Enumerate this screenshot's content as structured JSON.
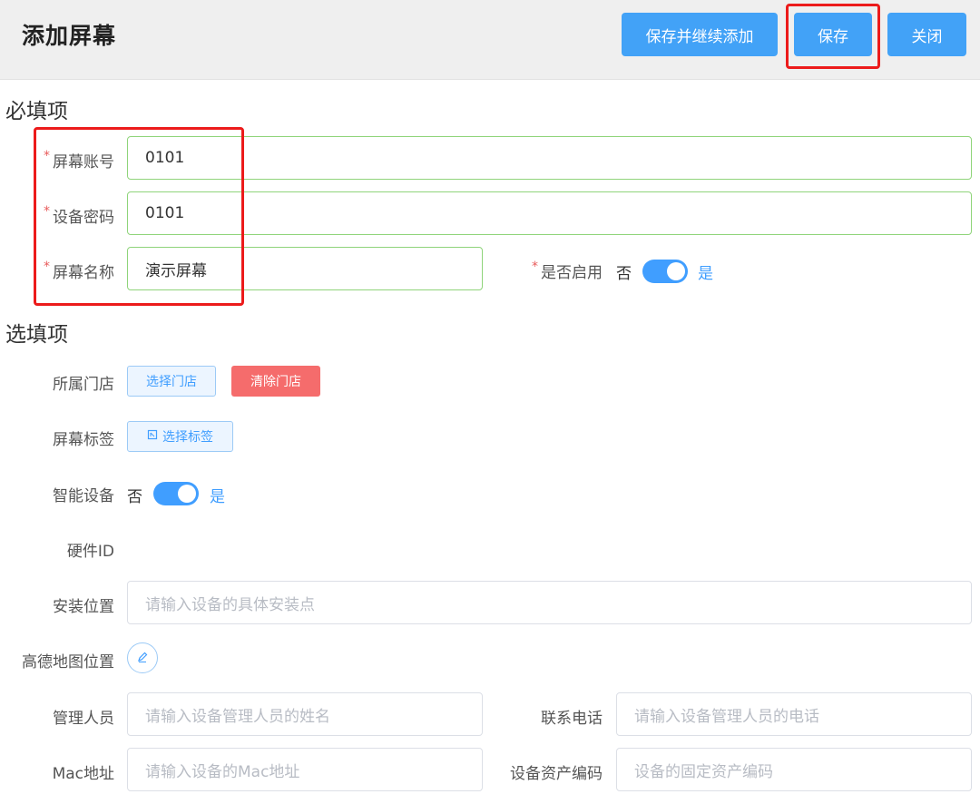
{
  "header": {
    "title": "添加屏幕",
    "save_continue_label": "保存并继续添加",
    "save_label": "保存",
    "close_label": "关闭"
  },
  "required_section": {
    "title": "必填项",
    "screen_account": {
      "label": "屏幕账号",
      "value": "0101"
    },
    "device_password": {
      "label": "设备密码",
      "value": "0101"
    },
    "screen_name": {
      "label": "屏幕名称",
      "value": "演示屏幕"
    },
    "enabled": {
      "label": "是否启用",
      "off_label": "否",
      "on_label": "是",
      "state": "on"
    },
    "required_mark": "*"
  },
  "optional_section": {
    "title": "选填项",
    "store": {
      "label": "所属门店",
      "select_label": "选择门店",
      "clear_label": "清除门店"
    },
    "tags": {
      "label": "屏幕标签",
      "select_label": "选择标签"
    },
    "smart_device": {
      "label": "智能设备",
      "off_label": "否",
      "on_label": "是",
      "state": "on"
    },
    "hardware_id": {
      "label": "硬件ID"
    },
    "install_location": {
      "label": "安装位置",
      "placeholder": "请输入设备的具体安装点"
    },
    "amap_location": {
      "label": "高德地图位置"
    },
    "manager": {
      "label": "管理人员",
      "placeholder": "请输入设备管理人员的姓名"
    },
    "phone": {
      "label": "联系电话",
      "placeholder": "请输入设备管理人员的电话"
    },
    "mac": {
      "label": "Mac地址",
      "placeholder": "请输入设备的Mac地址"
    },
    "asset_code": {
      "label": "设备资产编码",
      "placeholder": "设备的固定资产编码"
    }
  },
  "colors": {
    "primary": "#409eff",
    "danger": "#f56c6c",
    "highlight": "#ec1b1b",
    "valid_border": "#8fd47a"
  },
  "icons": {
    "tag": "tag-icon",
    "edit": "edit-pen-icon"
  }
}
